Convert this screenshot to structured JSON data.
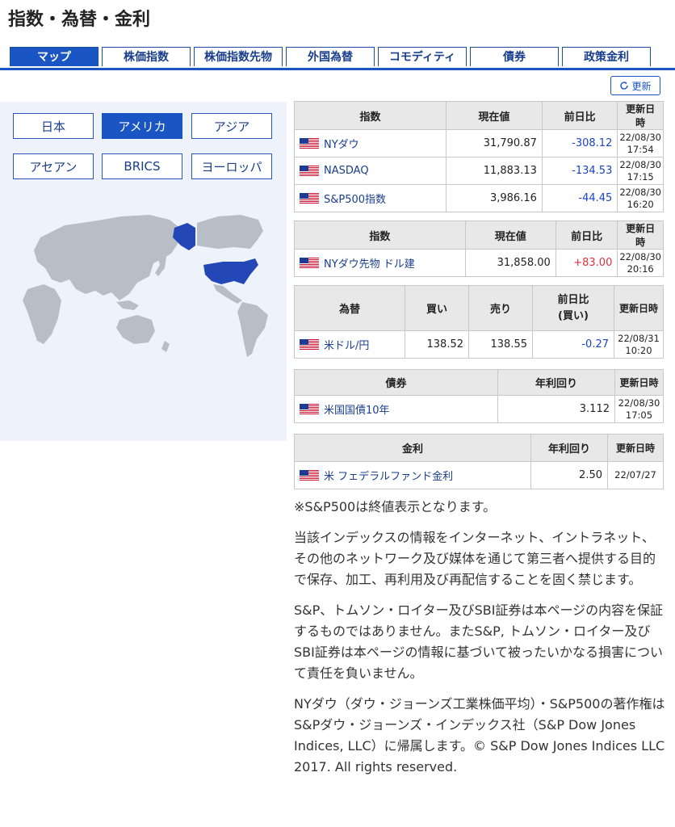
{
  "page_title": "指数・為替・金利",
  "tabs": [
    {
      "label": "マップ",
      "active": true
    },
    {
      "label": "株価指数"
    },
    {
      "label": "株価指数先物"
    },
    {
      "label": "外国為替"
    },
    {
      "label": "コモディティ"
    },
    {
      "label": "債券"
    },
    {
      "label": "政策金利"
    }
  ],
  "refresh_label": "更新",
  "regions": [
    "日本",
    "アメリカ",
    "アジア",
    "アセアン",
    "BRICS",
    "ヨーロッパ"
  ],
  "active_region": "アメリカ",
  "indices_table": {
    "headers": [
      "指数",
      "現在値",
      "前日比",
      "更新日時"
    ],
    "rows": [
      {
        "name": "NYダウ",
        "value": "31,790.87",
        "change": "-308.12",
        "date": "22/08/30",
        "time": "17:54"
      },
      {
        "name": "NASDAQ",
        "value": "11,883.13",
        "change": "-134.53",
        "date": "22/08/30",
        "time": "17:15"
      },
      {
        "name": "S&P500指数",
        "value": "3,986.16",
        "change": "-44.45",
        "date": "22/08/30",
        "time": "16:20"
      }
    ]
  },
  "futures_table": {
    "headers": [
      "指数",
      "現在値",
      "前日比",
      "更新日時"
    ],
    "rows": [
      {
        "name": "NYダウ先物 ドル建",
        "value": "31,858.00",
        "change": "+83.00",
        "date": "22/08/30",
        "time": "20:16"
      }
    ]
  },
  "fx_table": {
    "headers": [
      "為替",
      "買い",
      "売り",
      "前日比",
      "(買い)",
      "更新日時"
    ],
    "rows": [
      {
        "name": "米ドル/円",
        "bid": "138.52",
        "ask": "138.55",
        "change": "-0.27",
        "date": "22/08/31",
        "time": "10:20"
      }
    ]
  },
  "bond_table": {
    "headers": [
      "債券",
      "年利回り",
      "更新日時"
    ],
    "rows": [
      {
        "name": "米国国債10年",
        "yield": "3.112",
        "date": "22/08/30",
        "time": "17:05"
      }
    ]
  },
  "rate_table": {
    "headers": [
      "金利",
      "年利回り",
      "更新日時"
    ],
    "rows": [
      {
        "name": "米 フェデラルファンド金利",
        "yield": "2.50",
        "date": "22/07/27"
      }
    ]
  },
  "notes": [
    "※S&P500は終値表示となります。",
    "当該インデックスの情報をインターネット、イントラネット、その他のネットワーク及び媒体を通じて第三者へ提供する目的で保存、加工、再利用及び再配信することを固く禁じます。",
    "S&P、トムソン・ロイター及びSBI証券は本ページの内容を保証するものではありません。またS&P, トムソン・ロイター及びSBI証券は本ページの情報に基づいて被ったいかなる損害について責任を負いません。",
    "NYダウ（ダウ・ジョーンズ工業株価平均）・S&P500の著作権はS&Pダウ・ジョーンズ・インデックス社（S&P Dow Jones Indices, LLC）に帰属します。© S&P Dow Jones Indices LLC 2017. All rights reserved."
  ],
  "colors": {
    "accent": "#1a55c4",
    "negative": "#1a44c4",
    "positive": "#e0303f",
    "map_highlight": "#2447b8",
    "map_land": "#b9bec6"
  }
}
